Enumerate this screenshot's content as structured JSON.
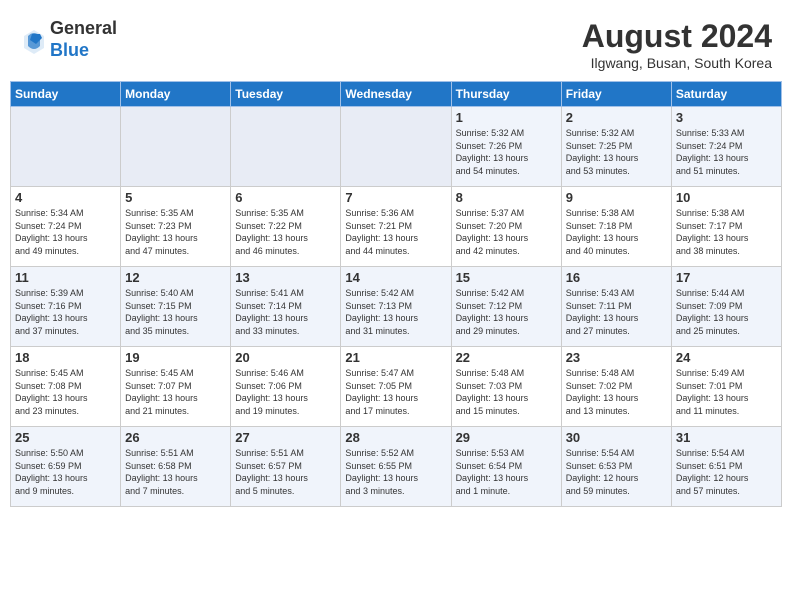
{
  "header": {
    "logo_line1": "General",
    "logo_line2": "Blue",
    "month_year": "August 2024",
    "location": "Ilgwang, Busan, South Korea"
  },
  "weekdays": [
    "Sunday",
    "Monday",
    "Tuesday",
    "Wednesday",
    "Thursday",
    "Friday",
    "Saturday"
  ],
  "weeks": [
    [
      {
        "day": "",
        "info": ""
      },
      {
        "day": "",
        "info": ""
      },
      {
        "day": "",
        "info": ""
      },
      {
        "day": "",
        "info": ""
      },
      {
        "day": "1",
        "info": "Sunrise: 5:32 AM\nSunset: 7:26 PM\nDaylight: 13 hours\nand 54 minutes."
      },
      {
        "day": "2",
        "info": "Sunrise: 5:32 AM\nSunset: 7:25 PM\nDaylight: 13 hours\nand 53 minutes."
      },
      {
        "day": "3",
        "info": "Sunrise: 5:33 AM\nSunset: 7:24 PM\nDaylight: 13 hours\nand 51 minutes."
      }
    ],
    [
      {
        "day": "4",
        "info": "Sunrise: 5:34 AM\nSunset: 7:24 PM\nDaylight: 13 hours\nand 49 minutes."
      },
      {
        "day": "5",
        "info": "Sunrise: 5:35 AM\nSunset: 7:23 PM\nDaylight: 13 hours\nand 47 minutes."
      },
      {
        "day": "6",
        "info": "Sunrise: 5:35 AM\nSunset: 7:22 PM\nDaylight: 13 hours\nand 46 minutes."
      },
      {
        "day": "7",
        "info": "Sunrise: 5:36 AM\nSunset: 7:21 PM\nDaylight: 13 hours\nand 44 minutes."
      },
      {
        "day": "8",
        "info": "Sunrise: 5:37 AM\nSunset: 7:20 PM\nDaylight: 13 hours\nand 42 minutes."
      },
      {
        "day": "9",
        "info": "Sunrise: 5:38 AM\nSunset: 7:18 PM\nDaylight: 13 hours\nand 40 minutes."
      },
      {
        "day": "10",
        "info": "Sunrise: 5:38 AM\nSunset: 7:17 PM\nDaylight: 13 hours\nand 38 minutes."
      }
    ],
    [
      {
        "day": "11",
        "info": "Sunrise: 5:39 AM\nSunset: 7:16 PM\nDaylight: 13 hours\nand 37 minutes."
      },
      {
        "day": "12",
        "info": "Sunrise: 5:40 AM\nSunset: 7:15 PM\nDaylight: 13 hours\nand 35 minutes."
      },
      {
        "day": "13",
        "info": "Sunrise: 5:41 AM\nSunset: 7:14 PM\nDaylight: 13 hours\nand 33 minutes."
      },
      {
        "day": "14",
        "info": "Sunrise: 5:42 AM\nSunset: 7:13 PM\nDaylight: 13 hours\nand 31 minutes."
      },
      {
        "day": "15",
        "info": "Sunrise: 5:42 AM\nSunset: 7:12 PM\nDaylight: 13 hours\nand 29 minutes."
      },
      {
        "day": "16",
        "info": "Sunrise: 5:43 AM\nSunset: 7:11 PM\nDaylight: 13 hours\nand 27 minutes."
      },
      {
        "day": "17",
        "info": "Sunrise: 5:44 AM\nSunset: 7:09 PM\nDaylight: 13 hours\nand 25 minutes."
      }
    ],
    [
      {
        "day": "18",
        "info": "Sunrise: 5:45 AM\nSunset: 7:08 PM\nDaylight: 13 hours\nand 23 minutes."
      },
      {
        "day": "19",
        "info": "Sunrise: 5:45 AM\nSunset: 7:07 PM\nDaylight: 13 hours\nand 21 minutes."
      },
      {
        "day": "20",
        "info": "Sunrise: 5:46 AM\nSunset: 7:06 PM\nDaylight: 13 hours\nand 19 minutes."
      },
      {
        "day": "21",
        "info": "Sunrise: 5:47 AM\nSunset: 7:05 PM\nDaylight: 13 hours\nand 17 minutes."
      },
      {
        "day": "22",
        "info": "Sunrise: 5:48 AM\nSunset: 7:03 PM\nDaylight: 13 hours\nand 15 minutes."
      },
      {
        "day": "23",
        "info": "Sunrise: 5:48 AM\nSunset: 7:02 PM\nDaylight: 13 hours\nand 13 minutes."
      },
      {
        "day": "24",
        "info": "Sunrise: 5:49 AM\nSunset: 7:01 PM\nDaylight: 13 hours\nand 11 minutes."
      }
    ],
    [
      {
        "day": "25",
        "info": "Sunrise: 5:50 AM\nSunset: 6:59 PM\nDaylight: 13 hours\nand 9 minutes."
      },
      {
        "day": "26",
        "info": "Sunrise: 5:51 AM\nSunset: 6:58 PM\nDaylight: 13 hours\nand 7 minutes."
      },
      {
        "day": "27",
        "info": "Sunrise: 5:51 AM\nSunset: 6:57 PM\nDaylight: 13 hours\nand 5 minutes."
      },
      {
        "day": "28",
        "info": "Sunrise: 5:52 AM\nSunset: 6:55 PM\nDaylight: 13 hours\nand 3 minutes."
      },
      {
        "day": "29",
        "info": "Sunrise: 5:53 AM\nSunset: 6:54 PM\nDaylight: 13 hours\nand 1 minute."
      },
      {
        "day": "30",
        "info": "Sunrise: 5:54 AM\nSunset: 6:53 PM\nDaylight: 12 hours\nand 59 minutes."
      },
      {
        "day": "31",
        "info": "Sunrise: 5:54 AM\nSunset: 6:51 PM\nDaylight: 12 hours\nand 57 minutes."
      }
    ]
  ]
}
